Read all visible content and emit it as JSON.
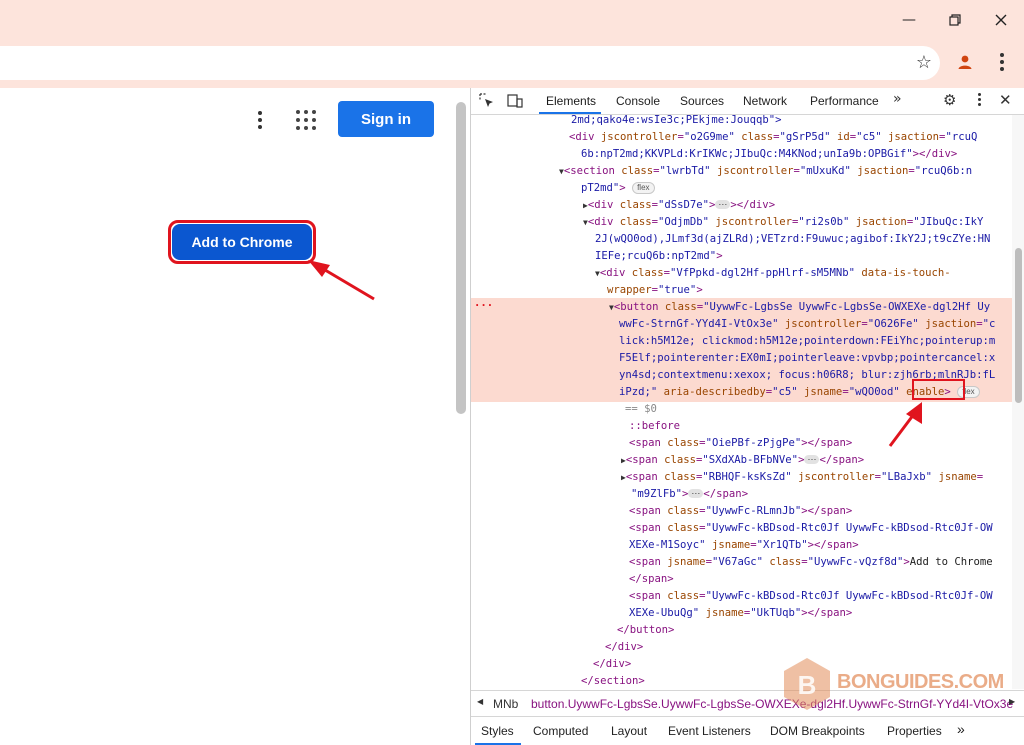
{
  "window": {
    "minimize_icon": "minimize-icon",
    "maximize_icon": "restore-icon",
    "close_icon": "close-icon"
  },
  "toolbar": {
    "bookmark_icon": "star-icon",
    "profile_icon": "person-icon",
    "menu_icon": "kebab-icon"
  },
  "page": {
    "sign_in_label": "Sign in",
    "add_to_chrome_label": "Add to Chrome"
  },
  "devtools": {
    "tabs": [
      "Elements",
      "Console",
      "Sources",
      "Network",
      "Performance"
    ],
    "active_tab": "Elements",
    "more_tabs": "»",
    "code_lines": {
      "l1": "2md;qako4e:wsIe3c;PEkjme:Jouqqb\">",
      "l2a": "<div ",
      "l2b": "jscontroller",
      "l2c": "\"o2G9me\"",
      "l2d": "class",
      "l2e": "\"gSrP5d\"",
      "l2f": "id",
      "l2g": "\"c5\"",
      "l2h": "jsaction",
      "l2i": "\"rcuQ",
      "l3": "6b:npT2md;KKVPLd:KrIKWc;JIbuQc:M4KNod;unIa9b:OPBGif\"",
      "l3b": "></div>",
      "l4a": "<section ",
      "l4b": "class",
      "l4c": "\"lwrbTd\"",
      "l4d": "jscontroller",
      "l4e": "\"mUxuKd\"",
      "l4f": "jsaction",
      "l4g": "\"rcuQ6b:n",
      "l5a": "pT2md\"",
      "l5b": ">",
      "l6a": "<div ",
      "l6b": "class",
      "l6c": "\"dSsD7e\"",
      "l6d": "></div>",
      "l7a": "<div ",
      "l7b": "class",
      "l7c": "\"OdjmDb\"",
      "l7d": "jscontroller",
      "l7e": "\"ri2s0b\"",
      "l7f": "jsaction",
      "l7g": "\"JIbuQc:IkY",
      "l8": "2J(wQO0od),JLmf3d(ajZLRd);VETzrd:F9uwuc;agibof:IkY2J;t9cZYe:HN",
      "l9a": "IEFe;rcuQ6b:npT2md\"",
      "l9b": ">",
      "l10a": "<div ",
      "l10b": "class",
      "l10c": "\"VfPpkd-dgl2Hf-ppHlrf-sM5MNb\"",
      "l10d": "data-is-touch-",
      "l11a": "wrapper",
      "l11b": "\"true\"",
      "l11c": ">",
      "l12a": "<button ",
      "l12b": "class",
      "l12c": "\"UywwFc-LgbsSe UywwFc-LgbsSe-OWXEXe-dgl2Hf Uy",
      "l13a": "wwFc-StrnGf-YYd4I-VtOx3e\"",
      "l13b": "jscontroller",
      "l13c": "\"O626Fe\"",
      "l13d": "jsaction",
      "l13e": "\"c",
      "l14": "lick:h5M12e; clickmod:h5M12e;pointerdown:FEiYhc;pointerup:m",
      "l15": "F5Elf;pointerenter:EX0mI;pointerleave:vpvbp;pointercancel:x",
      "l16": "yn4sd;contextmenu:xexox; focus:h06R8; blur:zjh6rb;mlnRJb:fL",
      "l17a": "iPzd;\"",
      "l17b": "aria-describedby",
      "l17c": "\"c5\"",
      "l17d": "jsname",
      "l17e": "\"wQO0od\"",
      "l17f": "enable",
      "l17g": ">",
      "l18": "== $0",
      "l19": "::before",
      "l20a": "<span ",
      "l20b": "class",
      "l20c": "\"OiePBf-zPjgPe\"",
      "l20d": "></span>",
      "l21a": "<span ",
      "l21b": "class",
      "l21c": "\"SXdXAb-BFbNVe\"",
      "l21d": "</span>",
      "l22a": "<span ",
      "l22b": "class",
      "l22c": "\"RBHQF-ksKsZd\"",
      "l22d": "jscontroller",
      "l22e": "\"LBaJxb\"",
      "l22f": "jsname",
      "l23a": "\"m9ZlFb\"",
      "l23b": "</span>",
      "l24a": "<span ",
      "l24b": "class",
      "l24c": "\"UywwFc-RLmnJb\"",
      "l24d": "></span>",
      "l25a": "<span ",
      "l25b": "class",
      "l25c": "\"UywwFc-kBDsod-Rtc0Jf UywwFc-kBDsod-Rtc0Jf-OW",
      "l26a": "XEXe-M1Soyc\"",
      "l26b": "jsname",
      "l26c": "\"Xr1QTb\"",
      "l26d": "></span>",
      "l27a": "<span ",
      "l27b": "jsname",
      "l27c": "\"V67aGc\"",
      "l27d": "class",
      "l27e": "\"UywwFc-vQzf8d\"",
      "l27f": ">",
      "l27g": "Add to Chrome",
      "l28": "</span>",
      "l29a": "<span ",
      "l29b": "class",
      "l29c": "\"UywwFc-kBDsod-Rtc0Jf UywwFc-kBDsod-Rtc0Jf-OW",
      "l30a": "XEXe-UbuQg\"",
      "l30b": "jsname",
      "l30c": "\"UkTUqb\"",
      "l30d": "></span>",
      "l31": "</button>",
      "l32": "</div>",
      "l33": "</div>",
      "l34": "</section>"
    },
    "badge_flex": "flex",
    "ellipsis": "···",
    "selected_marker": "···",
    "breadcrumb": {
      "prev": "MNb",
      "current": "button.UywwFc-LgbsSe.UywwFc-LgbsSe-OWXEXe-dgl2Hf.UywwFc-StrnGf-YYd4I-VtOx3e"
    },
    "bottom_tabs": [
      "Styles",
      "Computed",
      "Layout",
      "Event Listeners",
      "DOM Breakpoints",
      "Properties"
    ],
    "bottom_active": "Styles"
  },
  "watermark": {
    "letter": "B",
    "text": "BONGUIDES.COM"
  },
  "colors": {
    "accent": "#1a73e8",
    "highlight": "#e0141e",
    "selection": "#fcdad0"
  }
}
